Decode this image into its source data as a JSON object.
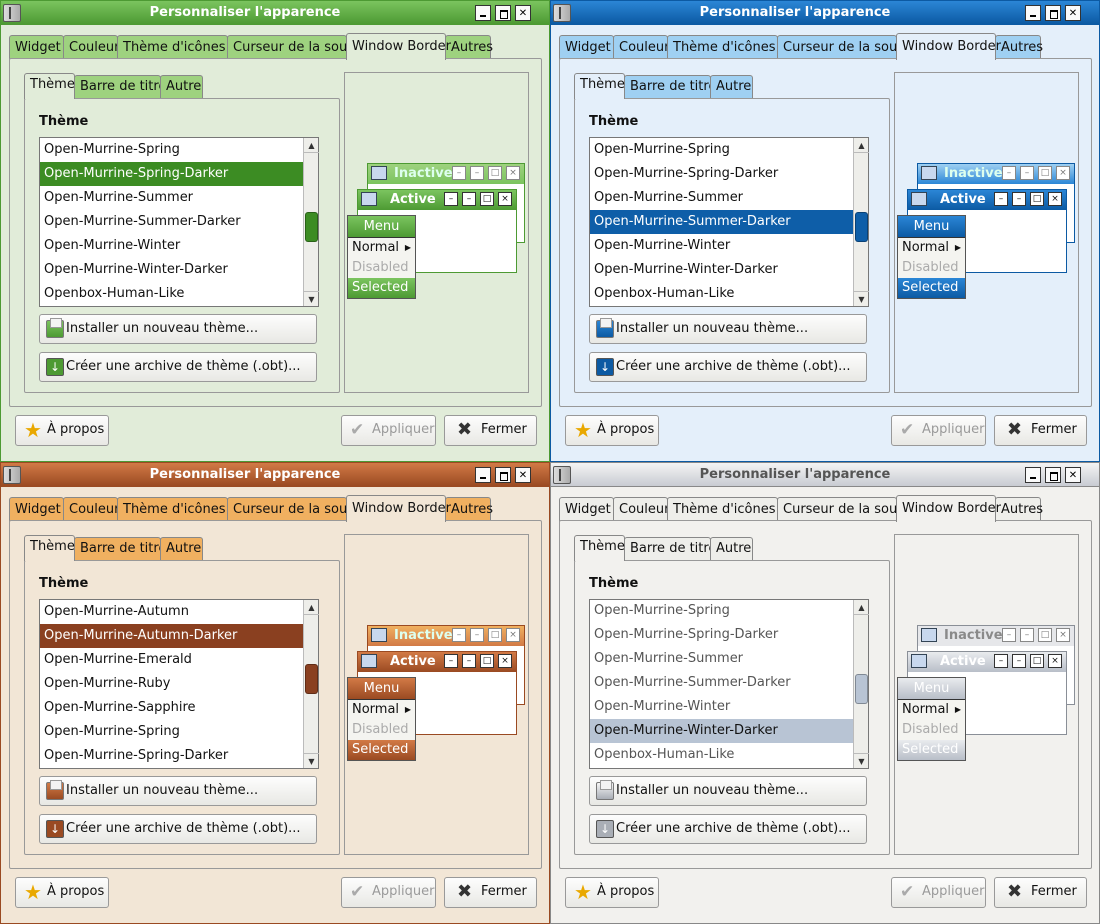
{
  "windows": [
    {
      "theme": "green",
      "colors": {
        "accent": "#3c8c23",
        "titlebar_top": "#7bc45f",
        "titlebar_bottom": "#4d9a33",
        "title_text": "#ffffff",
        "background": "#e1ecd9",
        "tab": "#9ed27f"
      },
      "title": "Personnaliser l'apparence",
      "tabs": [
        "Widget",
        "Couleur",
        "Thème d'icônes",
        "Curseur de la souris",
        "Window Border",
        "Autres"
      ],
      "active_tab": "Window Border",
      "subtabs": [
        "Thème",
        "Barre de titre",
        "Autre"
      ],
      "section_label": "Thème",
      "themes": [
        "Open-Murrine-Spring",
        "Open-Murrine-Spring-Darker",
        "Open-Murrine-Summer",
        "Open-Murrine-Summer-Darker",
        "Open-Murrine-Winter",
        "Open-Murrine-Winter-Darker",
        "Openbox-Human-Like"
      ],
      "selected_theme": "Open-Murrine-Spring-Darker",
      "scroll_fraction": 0.55,
      "install_button": "Installer un nouveau thème...",
      "archive_button": "Créer une archive de thème (.obt)...",
      "preview": {
        "inactive": "Inactive",
        "active": "Active",
        "menu_title": "Menu",
        "menu_items": [
          "Normal",
          "Disabled",
          "Selected"
        ]
      },
      "about_button": "À propos",
      "apply_button": "Appliquer",
      "close_button": "Fermer"
    },
    {
      "theme": "blue",
      "colors": {
        "accent": "#0e5ea8",
        "titlebar_top": "#2b86d6",
        "titlebar_bottom": "#0c5aa3",
        "title_text": "#ffffff",
        "background": "#e4effa",
        "tab": "#9fd0f2"
      },
      "title": "Personnaliser l'apparence",
      "tabs": [
        "Widget",
        "Couleur",
        "Thème d'icônes",
        "Curseur de la souris",
        "Window Border",
        "Autres"
      ],
      "active_tab": "Window Border",
      "subtabs": [
        "Thème",
        "Barre de titre",
        "Autre"
      ],
      "section_label": "Thème",
      "themes": [
        "Open-Murrine-Spring",
        "Open-Murrine-Spring-Darker",
        "Open-Murrine-Summer",
        "Open-Murrine-Summer-Darker",
        "Open-Murrine-Winter",
        "Open-Murrine-Winter-Darker",
        "Openbox-Human-Like"
      ],
      "selected_theme": "Open-Murrine-Summer-Darker",
      "scroll_fraction": 0.55,
      "install_button": "Installer un nouveau thème...",
      "archive_button": "Créer une archive de thème (.obt)...",
      "preview": {
        "inactive": "Inactive",
        "active": "Active",
        "menu_title": "Menu",
        "menu_items": [
          "Normal",
          "Disabled",
          "Selected"
        ]
      },
      "about_button": "À propos",
      "apply_button": "Appliquer",
      "close_button": "Fermer"
    },
    {
      "theme": "autumn",
      "colors": {
        "accent": "#8a4020",
        "titlebar_top": "#d27a46",
        "titlebar_bottom": "#9a4a22",
        "title_text": "#ffffff",
        "background": "#f2e6d6",
        "tab": "#f0b060"
      },
      "title": "Personnaliser l'apparence",
      "tabs": [
        "Widget",
        "Couleur",
        "Thème d'icônes",
        "Curseur de la souris",
        "Window Border",
        "Autres"
      ],
      "active_tab": "Window Border",
      "subtabs": [
        "Thème",
        "Barre de titre",
        "Autre"
      ],
      "section_label": "Thème",
      "themes": [
        "Open-Murrine-Autumn",
        "Open-Murrine-Autumn-Darker",
        "Open-Murrine-Emerald",
        "Open-Murrine-Ruby",
        "Open-Murrine-Sapphire",
        "Open-Murrine-Spring",
        "Open-Murrine-Spring-Darker"
      ],
      "selected_theme": "Open-Murrine-Autumn-Darker",
      "scroll_fraction": 0.45,
      "install_button": "Installer un nouveau thème...",
      "archive_button": "Créer une archive de thème (.obt)...",
      "preview": {
        "inactive": "Inactive",
        "active": "Active",
        "menu_title": "Menu",
        "menu_items": [
          "Normal",
          "Disabled",
          "Selected"
        ]
      },
      "about_button": "À propos",
      "apply_button": "Appliquer",
      "close_button": "Fermer"
    },
    {
      "theme": "winter",
      "colors": {
        "accent": "#b8c4d4",
        "titlebar_top": "#f4f4f4",
        "titlebar_bottom": "#c8cbd2",
        "title_text": "#555555",
        "background": "#f2f1ee",
        "tab": "#eeeeea"
      },
      "title": "Personnaliser l'apparence",
      "tabs": [
        "Widget",
        "Couleur",
        "Thème d'icônes",
        "Curseur de la souris",
        "Window Border",
        "Autres"
      ],
      "active_tab": "Window Border",
      "subtabs": [
        "Thème",
        "Barre de titre",
        "Autre"
      ],
      "section_label": "Thème",
      "themes": [
        "Open-Murrine-Spring",
        "Open-Murrine-Spring-Darker",
        "Open-Murrine-Summer",
        "Open-Murrine-Summer-Darker",
        "Open-Murrine-Winter",
        "Open-Murrine-Winter-Darker",
        "Openbox-Human-Like"
      ],
      "selected_theme": "Open-Murrine-Winter-Darker",
      "scroll_fraction": 0.55,
      "install_button": "Installer un nouveau thème...",
      "archive_button": "Créer une archive de thème (.obt)...",
      "preview": {
        "inactive": "Inactive",
        "active": "Active",
        "menu_title": "Menu",
        "menu_items": [
          "Normal",
          "Disabled",
          "Selected"
        ]
      },
      "about_button": "À propos",
      "apply_button": "Appliquer",
      "close_button": "Fermer"
    }
  ]
}
